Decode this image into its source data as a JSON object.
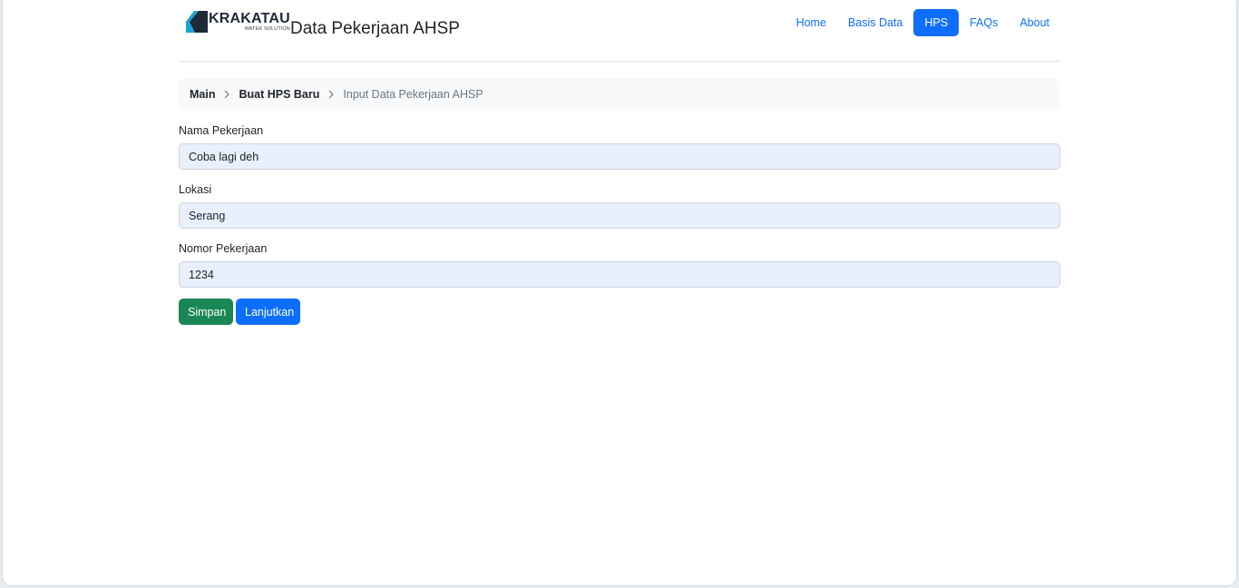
{
  "brand": {
    "logo_word": "KRAKATAU",
    "logo_sub": "WATER SOLUTION",
    "title": "Data Pekerjaan AHSP"
  },
  "nav": {
    "items": [
      {
        "label": "Home",
        "active": false
      },
      {
        "label": "Basis Data",
        "active": false
      },
      {
        "label": "HPS",
        "active": true
      },
      {
        "label": "FAQs",
        "active": false
      },
      {
        "label": "About",
        "active": false
      }
    ]
  },
  "breadcrumb": {
    "items": [
      "Main",
      "Buat HPS Baru",
      "Input Data Pekerjaan AHSP"
    ],
    "separator_icon": "chevron-right-icon"
  },
  "form": {
    "fields": [
      {
        "label": "Nama Pekerjaan",
        "value": "Coba lagi deh"
      },
      {
        "label": "Lokasi",
        "value": "Serang"
      },
      {
        "label": "Nomor Pekerjaan",
        "value": "1234"
      }
    ],
    "save_label": "Simpan",
    "next_label": "Lanjutkan"
  },
  "colors": {
    "primary": "#0d6efd",
    "success": "#198754",
    "logo_accent": "#1aa3d4",
    "input_bg": "#e8f0fe"
  }
}
